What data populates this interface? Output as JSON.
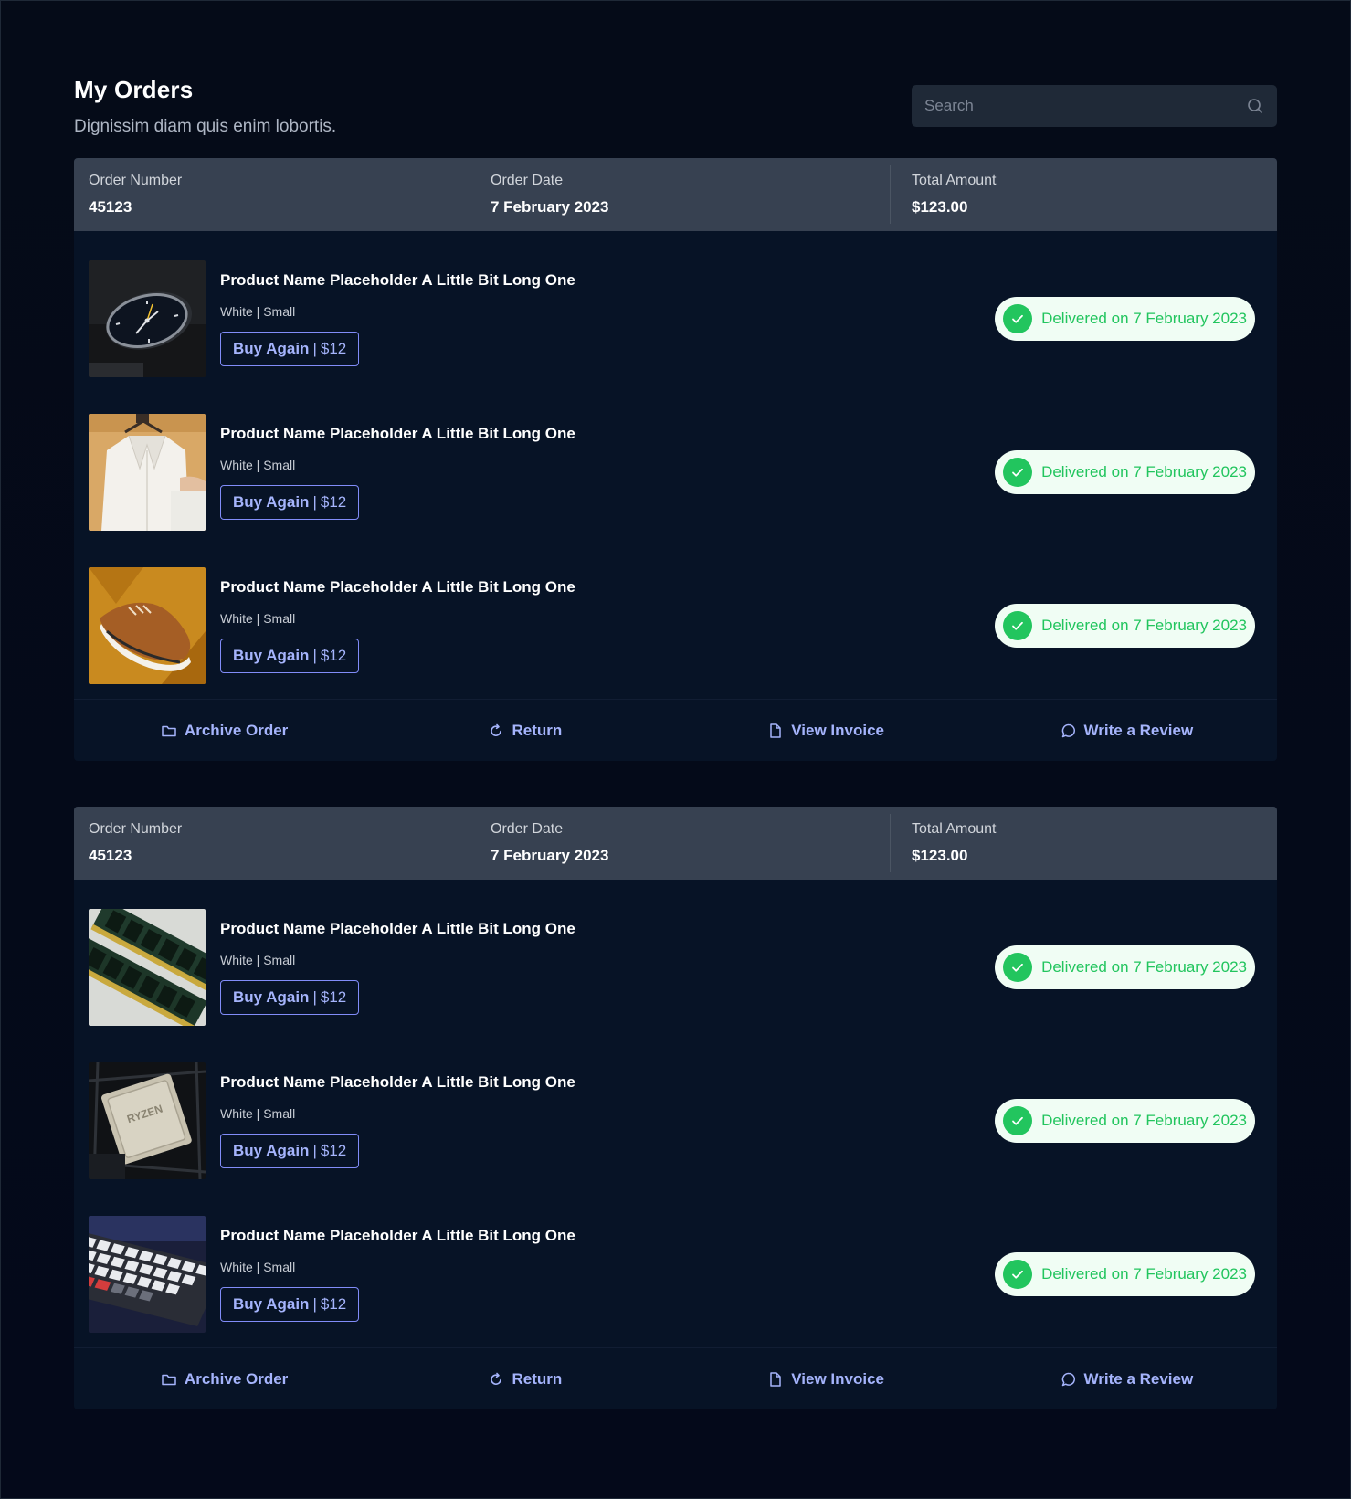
{
  "page": {
    "title": "My Orders",
    "subtitle": "Dignissim diam quis enim lobortis.",
    "search": {
      "placeholder": "Search",
      "icon": "search-icon"
    }
  },
  "labels": {
    "order_number": "Order Number",
    "order_date": "Order Date",
    "total_amount": "Total Amount",
    "buy_again": "Buy Again",
    "separator": "|"
  },
  "actions": {
    "archive": "Archive Order",
    "return": "Return",
    "invoice": "View Invoice",
    "review": "Write a Review"
  },
  "orders": [
    {
      "number": "45123",
      "date": "7 February 2023",
      "total": "$123.00",
      "items": [
        {
          "name": "Product Name Placeholder A Little Bit Long One",
          "variant": "White | Small",
          "price": "$12",
          "status": "Delivered on 7 February 2023",
          "image": "watch"
        },
        {
          "name": "Product Name Placeholder A Little Bit Long One",
          "variant": "White | Small",
          "price": "$12",
          "status": "Delivered on 7 February 2023",
          "image": "shirt"
        },
        {
          "name": "Product Name Placeholder A Little Bit Long One",
          "variant": "White | Small",
          "price": "$12",
          "status": "Delivered on 7 February 2023",
          "image": "sneaker"
        }
      ]
    },
    {
      "number": "45123",
      "date": "7 February 2023",
      "total": "$123.00",
      "items": [
        {
          "name": "Product Name Placeholder A Little Bit Long One",
          "variant": "White | Small",
          "price": "$12",
          "status": "Delivered on 7 February 2023",
          "image": "ram"
        },
        {
          "name": "Product Name Placeholder A Little Bit Long One",
          "variant": "White | Small",
          "price": "$12",
          "status": "Delivered on 7 February 2023",
          "image": "cpu"
        },
        {
          "name": "Product Name Placeholder A Little Bit Long One",
          "variant": "White | Small",
          "price": "$12",
          "status": "Delivered on 7 February 2023",
          "image": "keyboard"
        }
      ]
    }
  ],
  "colors": {
    "background": "#050b18",
    "card": "#071326",
    "card_header": "#374151",
    "accent": "#a5b4fc",
    "status_green": "#22c55e",
    "status_bg": "#f0fdf4"
  }
}
